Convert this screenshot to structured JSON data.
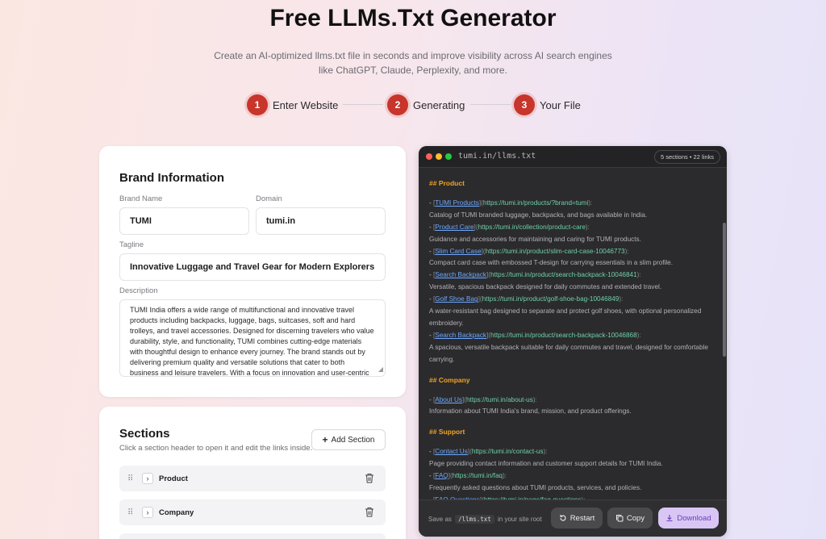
{
  "header": {
    "title": "Free LLMs.Txt Generator",
    "subtitle": "Create an AI-optimized llms.txt file in seconds and improve visibility across AI search engines like ChatGPT, Claude, Perplexity, and more."
  },
  "steps": [
    {
      "num": "1",
      "label": "Enter Website"
    },
    {
      "num": "2",
      "label": "Generating"
    },
    {
      "num": "3",
      "label": "Your File"
    }
  ],
  "brand": {
    "heading": "Brand Information",
    "brand_name_label": "Brand Name",
    "brand_name_value": "TUMI",
    "domain_label": "Domain",
    "domain_value": "tumi.in",
    "tagline_label": "Tagline",
    "tagline_value": "Innovative Luggage and Travel Gear for Modern Explorers",
    "description_label": "Description",
    "description_value": "TUMI India offers a wide range of multifunctional and innovative travel products including backpacks, luggage, bags, suitcases, soft and hard trolleys, and travel accessories. Designed for discerning travelers who value durability, style, and functionality, TUMI combines cutting-edge materials with thoughtful design to enhance every journey. The brand stands out by delivering premium quality and versatile solutions that cater to both business and leisure travelers. With a focus on innovation and user-centric"
  },
  "sections": {
    "heading": "Sections",
    "help": "Click a section header to open it and edit the links inside.",
    "add_label": "Add Section",
    "items": [
      {
        "name": "Product"
      },
      {
        "name": "Company"
      }
    ]
  },
  "editor": {
    "filename": "tumi.in/llms.txt",
    "badge": "5 sections • 22 links",
    "blocks": [
      {
        "heading": "## Product",
        "entries": [
          {
            "label": "TUMI Products",
            "url": "https://tumi.in/products/?brand=tumi",
            "desc": "Catalog of TUMI branded luggage, backpacks, and bags available in India."
          },
          {
            "label": "Product Care",
            "url": "https://tumi.in/collection/product-care",
            "desc": "Guidance and accessories for maintaining and caring for TUMI products."
          },
          {
            "label": "Slim Card Case",
            "url": "https://tumi.in/product/slim-card-case-10046773",
            "desc": "Compact card case with embossed T-design for carrying essentials in a slim profile."
          },
          {
            "label": "Search Backpack",
            "url": "https://tumi.in/product/search-backpack-10046841",
            "desc": "Versatile, spacious backpack designed for daily commutes and extended travel."
          },
          {
            "label": "Golf Shoe Bag",
            "url": "https://tumi.in/product/golf-shoe-bag-10046849",
            "desc": "A water-resistant bag designed to separate and protect golf shoes, with optional personalized embroidery."
          },
          {
            "label": "Search Backpack",
            "url": "https://tumi.in/product/search-backpack-10046868",
            "desc": "A spacious, versatile backpack suitable for daily commutes and travel, designed for comfortable carrying."
          }
        ]
      },
      {
        "heading": "## Company",
        "entries": [
          {
            "label": "About Us",
            "url": "https://tumi.in/about-us",
            "desc": "Information about TUMI India's brand, mission, and product offerings."
          }
        ]
      },
      {
        "heading": "## Support",
        "entries": [
          {
            "label": "Contact Us",
            "url": "https://tumi.in/contact-us",
            "desc": "Page providing contact information and customer support details for TUMI India."
          },
          {
            "label": "FAQ",
            "url": "https://tumi.in/faq",
            "desc": "Frequently asked questions about TUMI products, services, and policies."
          },
          {
            "label": "FAQ Questions",
            "url": "https://tumi.in/page/faq-questions",
            "desc": ""
          }
        ]
      }
    ],
    "save_prefix": "Save as",
    "save_file": "/llms.txt",
    "save_suffix": "in your site root",
    "restart_label": "Restart",
    "copy_label": "Copy",
    "download_label": "Download"
  },
  "colors": {
    "step_accent": "#c8352b",
    "editor_bg": "#2b2b2d",
    "heading_orange": "#f0a424",
    "link_blue": "#6ea8ff",
    "url_green": "#6fd0a8",
    "download_bg": "#d9c6f5"
  },
  "icons": {
    "add": "plus-icon",
    "drag": "drag-handle-icon",
    "expand": "chevron-right-icon",
    "delete": "trash-icon",
    "restart": "restart-icon",
    "copy": "copy-icon",
    "download": "download-icon"
  }
}
